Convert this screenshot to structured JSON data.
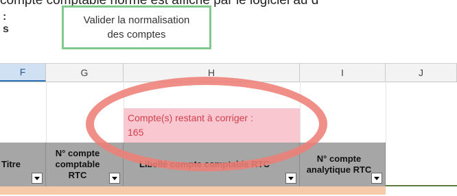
{
  "caption": "compte comptable normé est affiché par le logiciel au d",
  "left_marks": ":\ns",
  "validate_button": {
    "label": "Valider la normalisation\ndes comptes"
  },
  "columns": [
    {
      "label": "F",
      "selected": true
    },
    {
      "label": "G",
      "selected": false
    },
    {
      "label": "H",
      "selected": false
    },
    {
      "label": "I",
      "selected": false
    },
    {
      "label": "J",
      "selected": false
    }
  ],
  "remaining": {
    "text": "Compte(s) restant à corriger :",
    "count": "165"
  },
  "table_headers": [
    {
      "label": "Titre"
    },
    {
      "label": "N° compte\ncomptable\nRTC"
    },
    {
      "label": "Libellé compte comptable RTC"
    },
    {
      "label": "N° compte\nanalytique RTC"
    }
  ],
  "colors": {
    "button_border": "#7fc98a",
    "warning_bg": "#f8c7cf",
    "warning_text": "#d33e4d",
    "header_bg": "#a6a6a6",
    "row_bg": "#f7cba9",
    "annotation": "#ee8076"
  }
}
